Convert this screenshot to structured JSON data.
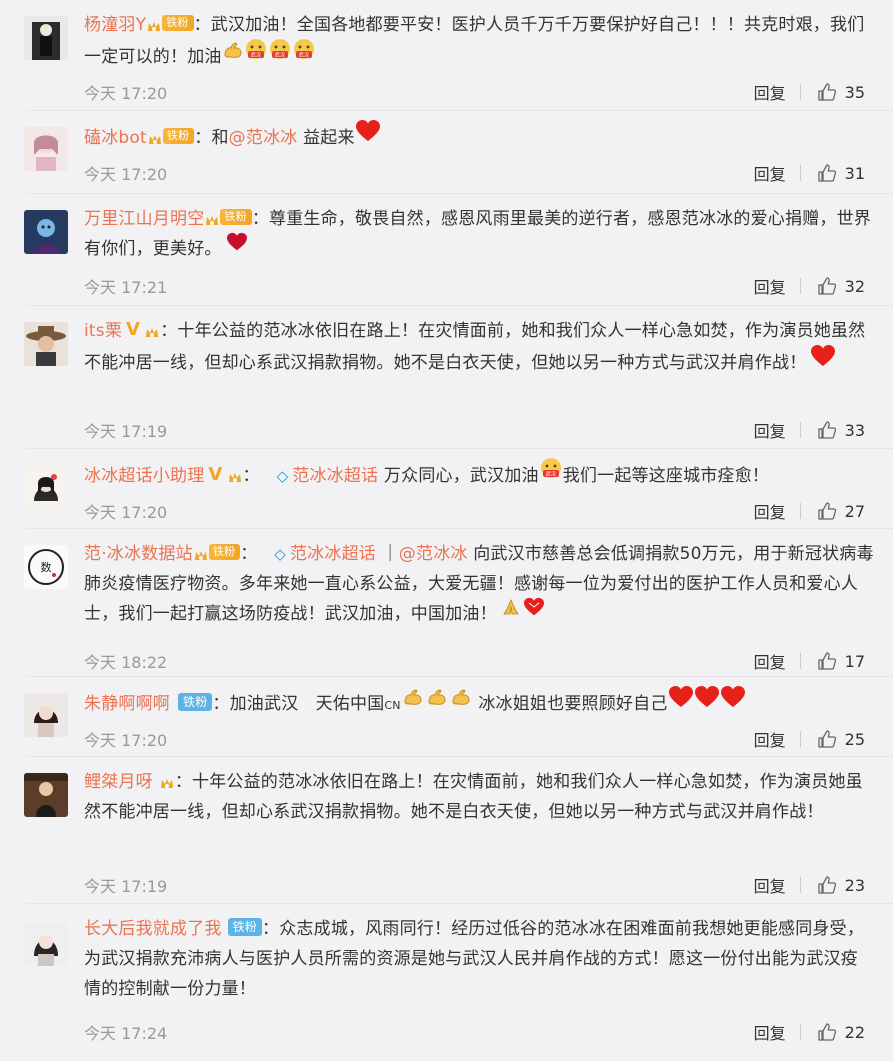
{
  "comments": [
    {
      "username": "杨潼羽Y",
      "badge": "铁粉",
      "segments": [
        "：武汉加油！全国各地都要平安！医护人员千万千万要保护好自己！！！共克时艰，我们一定可以的！加油"
      ],
      "time": "今天 17:20",
      "reply": "回复",
      "likes": "35"
    },
    {
      "username": "磕冰bot",
      "badge": "铁粉",
      "prefix": "：和",
      "mention": "@范冰冰",
      "suffix": " 益起来",
      "time": "今天 17:20",
      "reply": "回复",
      "likes": "31"
    },
    {
      "username": "万里江山月明空",
      "badge": "铁粉",
      "text": "：尊重生命，敬畏自然，感恩风雨里最美的逆行者，感恩范冰冰的爱心捐赠，世界有你们，更美好。",
      "time": "今天 17:21",
      "reply": "回复",
      "likes": "32"
    },
    {
      "username": "its栗",
      "text": "：十年公益的范冰冰依旧在路上！在灾情面前，她和我们众人一样心急如焚，作为演员她虽然不能冲居一线，但却心系武汉捐款捐物。她不是白衣天使，但她以另一种方式与武汉并肩作战！",
      "time": "今天 17:19",
      "reply": "回复",
      "likes": "33"
    },
    {
      "username": "冰冰超话小助理",
      "topic": "范冰冰超话",
      "text": " 万众同心，武汉加油",
      "text2": "我们一起等这座城市痊愈！",
      "time": "今天 17:20",
      "reply": "回复",
      "likes": "27"
    },
    {
      "username": "范·冰冰数据站",
      "badge": "铁粉",
      "topic": "范冰冰超话",
      "bar": " ｜",
      "mention": "@范冰冰",
      "text": " 向武汉市慈善总会低调捐款50万元，用于新冠状病毒肺炎疫情医疗物资。多年来她一直心系公益，大爱无疆！感谢每一位为爱付出的医护工作人员和爱心人士，我们一起打赢这场防疫战！武汉加油，中国加油！",
      "time": "今天 18:22",
      "reply": "回复",
      "likes": "17"
    },
    {
      "username": "朱静啊啊啊",
      "badge": "铁粉",
      "text": "：加油武汉　天佑中国",
      "cn": "CN",
      "text2": " 冰冰姐姐也要照顾好自己",
      "time": "今天 17:20",
      "reply": "回复",
      "likes": "25"
    },
    {
      "username": "鲤桀月呀",
      "text": "：十年公益的范冰冰依旧在路上！在灾情面前，她和我们众人一样心急如焚，作为演员她虽然不能冲居一线，但却心系武汉捐款捐物。她不是白衣天使，但她以另一种方式与武汉并肩作战！",
      "time": "今天 17:19",
      "reply": "回复",
      "likes": "23"
    },
    {
      "username": "长大后我就成了我",
      "badge": "铁粉",
      "text": "：众志成城，风雨同行！经历过低谷的范冰冰在困难面前我想她更能感同身受，为武汉捐款充沛病人与医护人员所需的资源是她与武汉人民并肩作战的方式！愿这一份付出能为武汉疫情的控制献一份力量！",
      "time": "今天 17:24",
      "reply": "回复",
      "likes": "22"
    }
  ],
  "colors": {
    "username": "#eb7350",
    "badge_gold": "#f2a623",
    "badge_blue": "#5cb4e6",
    "topic_icon": "#1e96c8",
    "time": "#999999",
    "background": "#f2f2f5"
  },
  "icons": {
    "like": "thumbs-up-icon",
    "badge": "fan-crown-icon",
    "topic": "diamond-topic-icon",
    "heart": "red-heart-emoji",
    "cheer": "wuhan-cheer-face-emoji",
    "muscle": "flexed-biceps-emoji",
    "pray": "folded-hands-emoji"
  }
}
